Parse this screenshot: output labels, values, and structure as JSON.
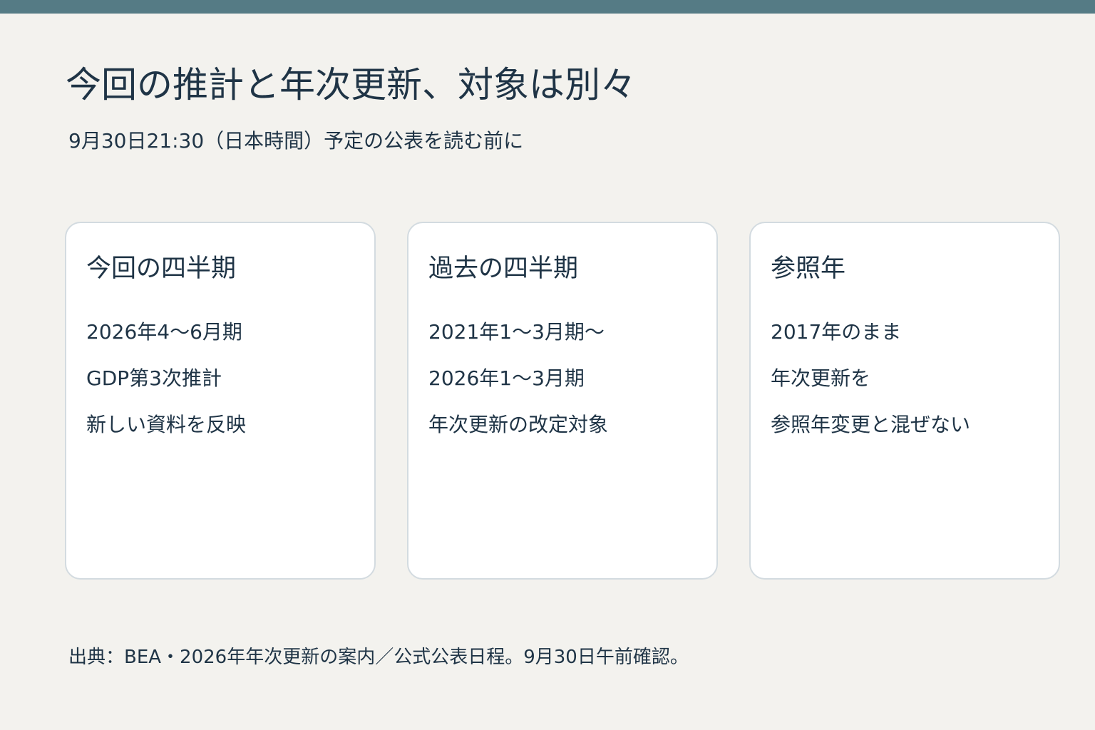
{
  "header": {
    "title": "今回の推計と年次更新、対象は別々",
    "subtitle": "9月30日21:30（日本時間）予定の公表を読む前に"
  },
  "cards": [
    {
      "title": "今回の四半期",
      "lines": [
        "2026年4～6月期",
        "GDP第3次推計",
        "新しい資料を反映"
      ]
    },
    {
      "title": "過去の四半期",
      "lines": [
        "2021年1～3月期～",
        "2026年1～3月期",
        "年次更新の改定対象"
      ]
    },
    {
      "title": "参照年",
      "lines": [
        "2017年のまま",
        "年次更新を",
        "参照年変更と混ぜない"
      ]
    }
  ],
  "footer": {
    "source": "出典：BEA・2026年年次更新の案内／公式公表日程。9月30日午前確認。"
  },
  "colors": {
    "background": "#f3f2ee",
    "top_bar": "#557b85",
    "text": "#1f3446",
    "card_background": "#ffffff",
    "card_border": "#d3dbe0"
  }
}
